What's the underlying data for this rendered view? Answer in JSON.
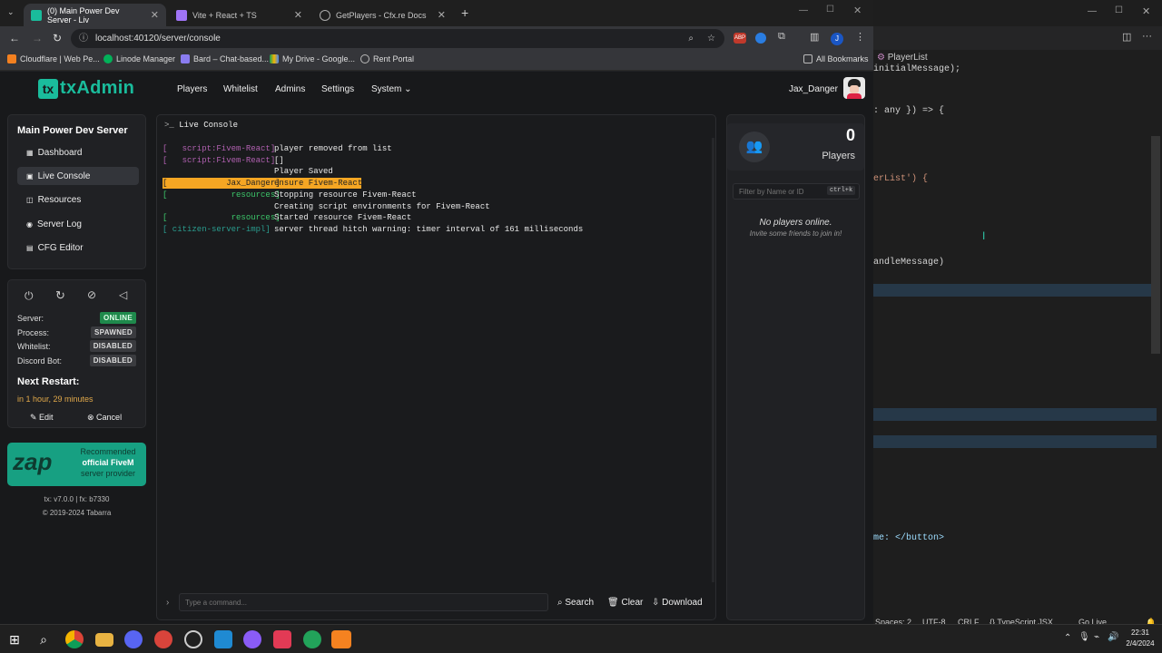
{
  "browser": {
    "tabs": [
      {
        "label": "(0) Main Power Dev Server - Liv",
        "active": true
      },
      {
        "label": "Vite + React + TS",
        "active": false
      },
      {
        "label": "GetPlayers - Cfx.re Docs",
        "active": false
      }
    ],
    "new_tab": "+",
    "url": "localhost:40120/server/console",
    "bookmarks": [
      "Cloudflare | Web Pe...",
      "Linode Manager",
      "Bard – Chat-based...",
      "My Drive - Google...",
      "Rent Portal"
    ],
    "all_bookmarks": "All Bookmarks"
  },
  "app": {
    "logo": "txAdmin",
    "nav": [
      "Players",
      "Whitelist",
      "Admins",
      "Settings",
      "System ⌄"
    ],
    "user": "Jax_Danger",
    "server_name": "Main Power Dev Server",
    "sidebar": [
      "Dashboard",
      "Live Console",
      "Resources",
      "Server Log",
      "CFG Editor"
    ],
    "status": {
      "server_label": "Server:",
      "server_value": "ONLINE",
      "process_label": "Process:",
      "process_value": "SPAWNED",
      "whitelist_label": "Whitelist:",
      "whitelist_value": "DISABLED",
      "discord_label": "Discord Bot:",
      "discord_value": "DISABLED"
    },
    "next_restart_title": "Next Restart:",
    "next_restart_value": "in 1 hour, 29 minutes",
    "edit": "Edit",
    "cancel": "Cancel",
    "ad": {
      "brand": "zap",
      "line1": "Recommended",
      "line2": "official FiveM",
      "line3": "server provider"
    },
    "version": "tx: v7.0.0 | fx: b7330",
    "copyright": "© 2019-2024 Tabarra",
    "console_title": "Live Console",
    "console_lines": [
      {
        "tag": "[   script:Fivem-React]",
        "msg": "player removed from list",
        "color": "#b060b0"
      },
      {
        "tag": "[   script:Fivem-React]",
        "msg": "[]",
        "color": "#b060b0"
      },
      {
        "tag": "",
        "msg": "Player Saved",
        "color": "#b060b0"
      },
      {
        "tag": "[            Jax_Danger]",
        "msg": "ensure Fivem-React",
        "color": "#222",
        "highlight": true
      },
      {
        "tag": "[             resources]",
        "msg": "Stopping resource Fivem-React",
        "color": "#3cc66a"
      },
      {
        "tag": "",
        "msg": "Creating script environments for Fivem-React",
        "color": "#c0392b"
      },
      {
        "tag": "[             resources]",
        "msg": "Started resource Fivem-React",
        "color": "#3cc66a"
      },
      {
        "tag": "[ citizen-server-impl]",
        "msg": "server thread hitch warning: timer interval of 161 milliseconds",
        "color": "#2a9d8f"
      }
    ],
    "command_placeholder": "Type a command...",
    "search": "Search",
    "clear": "Clear",
    "download": "Download",
    "players_count": "0",
    "players_label": "Players",
    "filter_placeholder": "Filter by Name or ID",
    "filter_shortcut": "ctrl+k",
    "no_players": "No players online.",
    "invite": "Invite some friends to join in!"
  },
  "vscode": {
    "tab": "PlayerList",
    "code_lines": [
      "initialMessage);",
      ": any }) => {",
      "erList') {",
      "andleMessage)",
      "me: </button>"
    ],
    "status": [
      "Spaces: 2",
      "UTF-8",
      "CRLF",
      "{} TypeScript JSX",
      "Go Live"
    ]
  },
  "taskbar": {
    "time": "22:31",
    "date": "2/4/2024"
  }
}
